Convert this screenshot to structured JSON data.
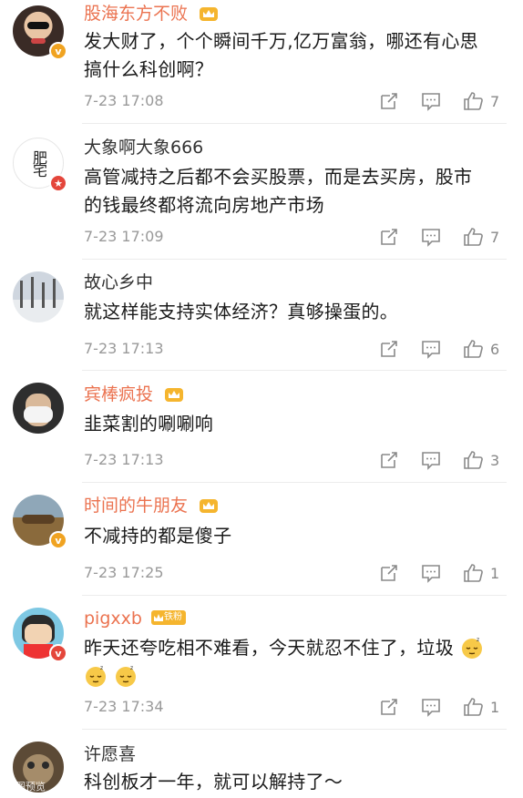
{
  "comments": [
    {
      "user": "股海东方不败",
      "vip": true,
      "text_lines": [
        "发大财了，个个瞬间千万,亿万富翁，哪还有心思",
        "搞什么科创啊？"
      ],
      "time": "7-23 17:08",
      "likes": "7",
      "avatar_badge": "v"
    },
    {
      "user": "大象啊大象666",
      "vip": false,
      "text_lines": [
        "高管减持之后都不会买股票，而是去买房，股市",
        "的钱最终都将流向房地产市场"
      ],
      "time": "7-23 17:09",
      "likes": "7",
      "avatar_badge": "red",
      "avatar_text": "肥宅"
    },
    {
      "user": "故心乡中",
      "vip": false,
      "text_lines": [
        "就这样能支持实体经济？真够操蛋的。"
      ],
      "time": "7-23 17:13",
      "likes": "6"
    },
    {
      "user": "宾棒疯投",
      "vip": true,
      "text_lines": [
        "韭菜割的唰唰响"
      ],
      "time": "7-23 17:13",
      "likes": "3"
    },
    {
      "user": "时间的牛朋友",
      "vip": true,
      "text_lines": [
        "不减持的都是傻子"
      ],
      "time": "7-23 17:25",
      "likes": "1",
      "avatar_badge": "v"
    },
    {
      "user": "pigxxb",
      "vip": true,
      "fan_badge": "铁粉",
      "text_lines": [
        "昨天还夸吃相不难看，今天就忍不住了，垃圾"
      ],
      "time": "7-23 17:34",
      "likes": "1",
      "avatar_badge": "red"
    },
    {
      "user": "许愿喜",
      "vip": false,
      "text_lines": [
        "科创板才一年，就可以解持了～"
      ]
    }
  ],
  "watermark": "大图预览",
  "icons": [
    "repost-icon",
    "comment-icon",
    "like-icon",
    "crown-icon",
    "sleepy-emoji"
  ],
  "colors": {
    "vip_name": "#eb7350",
    "meta": "#999999",
    "crown": "#f5b52e"
  }
}
